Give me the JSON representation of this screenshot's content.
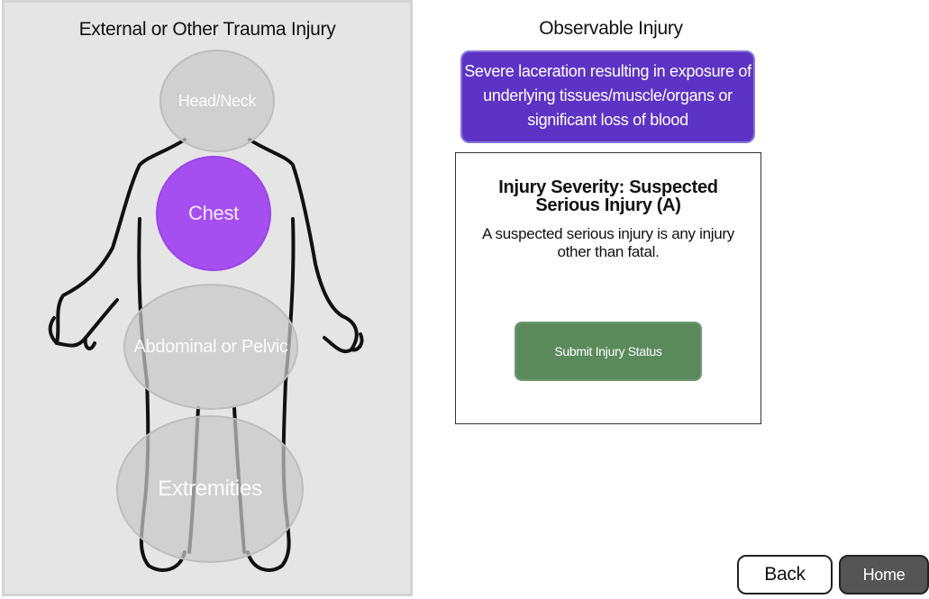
{
  "left_panel": {
    "title": "External or Other Trauma Injury",
    "zones": {
      "head": "Head/Neck",
      "chest": "Chest",
      "abdominal": "Abdominal or Pelvic",
      "extremities": "Extremities"
    },
    "selected_zone": "Chest"
  },
  "observable": {
    "title": "Observable Injury",
    "selected_text": "Severe laceration resulting in exposure of underlying tissues/muscle/organs or significant loss of blood"
  },
  "severity": {
    "title": "Injury Severity: Suspected Serious Injury (A)",
    "description": "A suspected serious injury is any injury other than fatal.",
    "submit_label": "Submit Injury Status"
  },
  "nav": {
    "back_label": "Back",
    "home_label": "Home"
  },
  "colors": {
    "panel_bg": "#e5e5e5",
    "selected_zone": "#a64ff0",
    "observable_box": "#5c33c4",
    "submit_button": "#5a8a5c",
    "home_button": "#555555"
  }
}
